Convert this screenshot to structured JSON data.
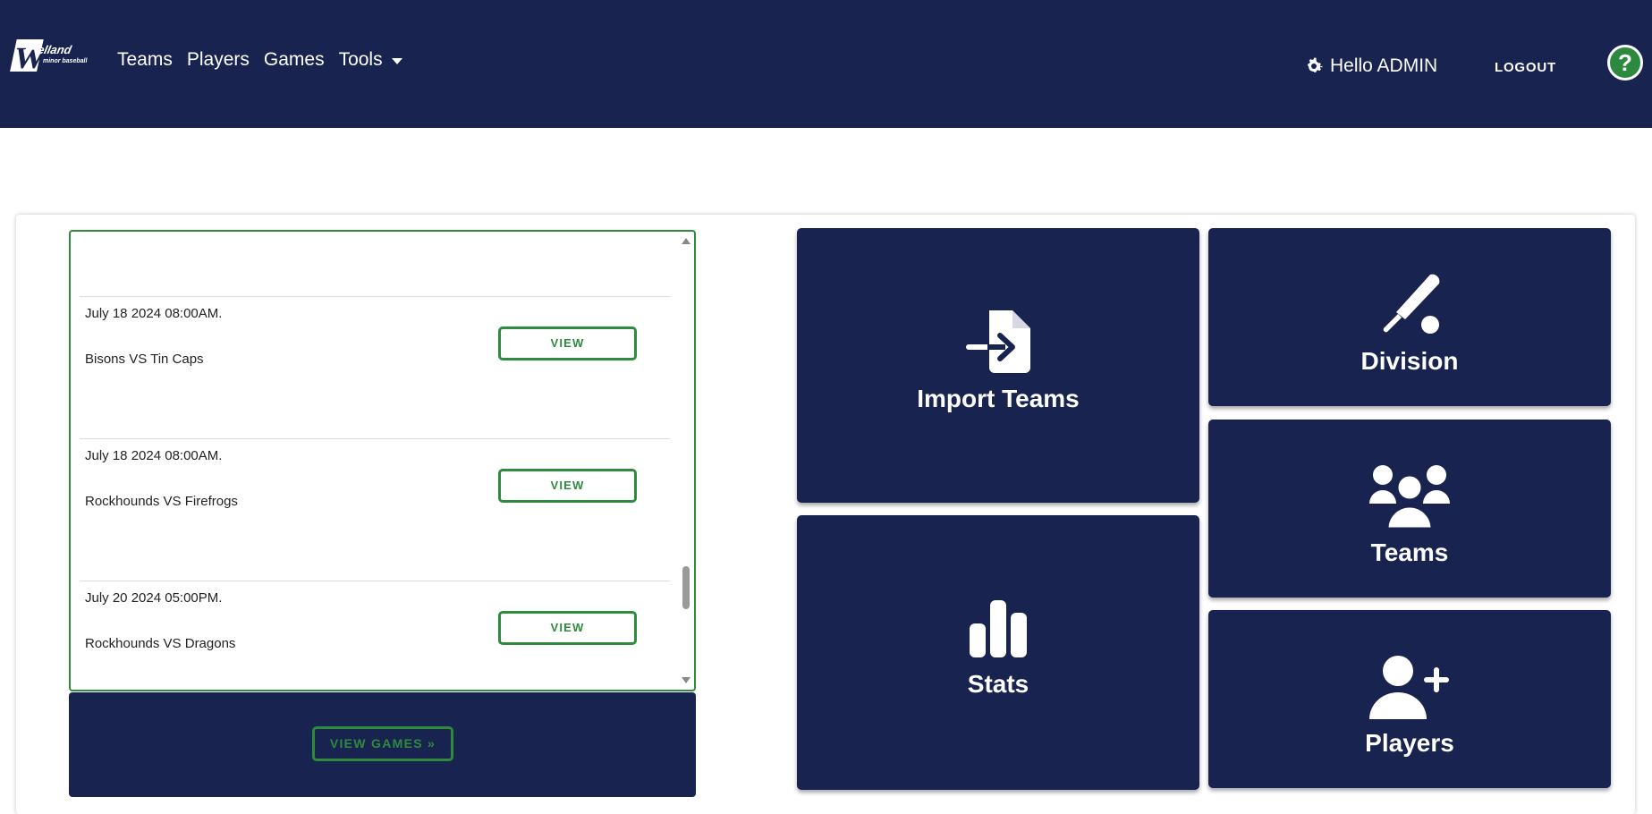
{
  "header": {
    "logo_text": "Welland minor baseball",
    "nav": [
      "Teams",
      "Players",
      "Games",
      "Tools"
    ],
    "user_greeting": "Hello ADMIN",
    "logout": "LOGOUT",
    "help": "?"
  },
  "games": [
    {
      "date": "July 18 2024 08:00AM.",
      "matchup": "Bisons VS Tin Caps",
      "button": "VIEW"
    },
    {
      "date": "July 18 2024 08:00AM.",
      "matchup": "Rockhounds VS Firefrogs",
      "button": "VIEW"
    },
    {
      "date": "July 20 2024 05:00PM.",
      "matchup": "Rockhounds VS Dragons",
      "button": "VIEW"
    }
  ],
  "view_games_label": "VIEW GAMES »",
  "tiles": {
    "import_teams": "Import Teams",
    "division": "Division",
    "teams": "Teams",
    "stats": "Stats",
    "players": "Players"
  },
  "colors": {
    "navy": "#18234f",
    "green": "#2e8b3e"
  }
}
